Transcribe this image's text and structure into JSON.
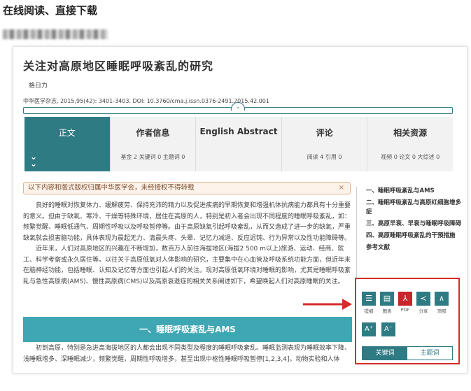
{
  "heading": "在线阅读、直接下载",
  "article": {
    "title": "关注对高原地区睡眠呼吸紊乱的研究",
    "author": "格日力",
    "citation": "中华医学杂志, 2015,95(42): 3401-3403. DOI: 10.3760/cma.j.issn.0376-2491.2015.42.001"
  },
  "reading_progress_percent": 0,
  "tabs": [
    {
      "label": "正文",
      "sub": ""
    },
    {
      "label": "作者信息",
      "sub": "基金 2 关键词 0 主题词 0"
    },
    {
      "label": "English Abstract",
      "sub": ""
    },
    {
      "label": "评论",
      "sub": "阅读 4 引用 0"
    },
    {
      "label": "相关资源",
      "sub": "视频 0 论文 0 大综述 0"
    }
  ],
  "notice": {
    "text": "以下内容和版式版权归属中华医学会，未经授权不得转载",
    "close": "×"
  },
  "body": {
    "p1": "良好的睡眠对恢复体力、缓解疲劳、保持充沛的精力以及促进疾病的早期恢复和增强机体抗病能力都具有十分重要的意义。但由于缺氧、寒冷、干燥等特殊环境，居住在高原的人，特别是初入者会出现不同程度的睡眠呼吸紊乱，如：频繁觉醒、睡眠低通气、周期性呼吸以及呼吸暂停等。由于高原缺氧引起呼吸紊乱，从而又造成了进一步的缺氧，严重缺氧就会损害脑功能，具体表现为晨起无力、清晨头疼、头晕、记忆力减退、反应迟钝、行为异常以及性功能障碍等。",
    "p2": "近年来，人们对高原地区的兴趣在不断增加，数百万人前往海拔地区(海拔2 500 m以上)旅游、运动、经商、就工、科学考察或永久居住等。以往关于高原低氧对人体影响的研究，主要集中在心血管及呼吸系统功能方面，但近年来在脑神经功能，包括睡眠、认知及记忆等方面也引起人们的关注。现对高原低氧环境对睡眠的影响，尤其是睡眠呼吸紊乱与急性高原病(AMS)、慢性高原病(CMS)以及高原衰退症的相关关系阐述如下，希望唤起人们对高原睡眠的关注。"
  },
  "section": {
    "title": "一、睡眠呼吸紊乱与AMS"
  },
  "body2": {
    "p1": "初到高原，特别是急进高海拔地区的人都会出现不同类型及程度的睡眠呼吸紊乱。睡眠监测表现为睡眠效率下降、浅睡眠增多、深睡眠减少，频繁觉醒，周期性呼吸增多，甚至出现中枢性睡眠呼吸暂停[1,2,3,4]。动物实验和人体"
  },
  "toc": [
    "一、睡眠呼吸紊乱与AMS",
    "二、睡眠呼吸紊乱与高原红细胞增多症",
    "三、高原早衰、早衰与睡眠呼吸障碍",
    "四、高原睡眠呼吸紊乱的干预措施",
    "参考文献"
  ],
  "tools": [
    {
      "icon": "list-icon",
      "glyph": "☰",
      "label": "提纲",
      "color": "#2f7b84"
    },
    {
      "icon": "image-icon",
      "glyph": "▤",
      "label": "图表",
      "color": "#2f7b84"
    },
    {
      "icon": "pdf-icon",
      "glyph": "⅄",
      "label": "PDF",
      "color": "#c8252c"
    },
    {
      "icon": "share-icon",
      "glyph": "≺",
      "label": "分享",
      "color": "#2f7b84"
    },
    {
      "icon": "top-icon",
      "glyph": "∧",
      "label": "顶部",
      "color": "#2f7b84"
    }
  ],
  "font_buttons": [
    "A⁺",
    "A⁻"
  ],
  "keyword_tabs": [
    "关键词",
    "主题词"
  ],
  "colors": {
    "accent": "#2f7b84",
    "highlight": "#d62b2b",
    "section": "#3fa7b4"
  }
}
